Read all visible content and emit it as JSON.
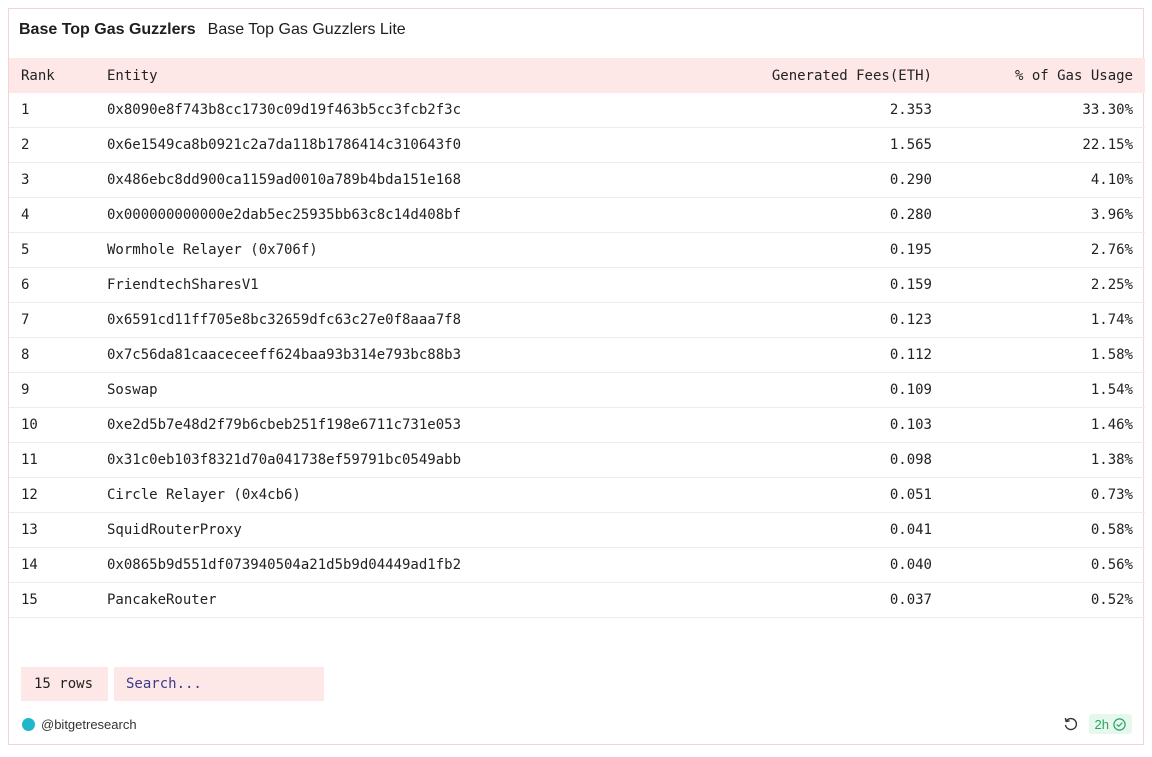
{
  "header": {
    "title": "Base Top Gas Guzzlers",
    "subtitle": "Base Top Gas Guzzlers Lite"
  },
  "table": {
    "columns": [
      "Rank",
      "Entity",
      "Generated Fees(ETH)",
      "% of Gas Usage"
    ],
    "rows": [
      {
        "rank": "1",
        "entity": "0x8090e8f743b8cc1730c09d19f463b5cc3fcb2f3c",
        "fees": "2.353",
        "pct": "33.30%"
      },
      {
        "rank": "2",
        "entity": "0x6e1549ca8b0921c2a7da118b1786414c310643f0",
        "fees": "1.565",
        "pct": "22.15%"
      },
      {
        "rank": "3",
        "entity": "0x486ebc8dd900ca1159ad0010a789b4bda151e168",
        "fees": "0.290",
        "pct": "4.10%"
      },
      {
        "rank": "4",
        "entity": "0x000000000000e2dab5ec25935bb63c8c14d408bf",
        "fees": "0.280",
        "pct": "3.96%"
      },
      {
        "rank": "5",
        "entity": "Wormhole Relayer (0x706f)",
        "fees": "0.195",
        "pct": "2.76%"
      },
      {
        "rank": "6",
        "entity": "FriendtechSharesV1",
        "fees": "0.159",
        "pct": "2.25%"
      },
      {
        "rank": "7",
        "entity": "0x6591cd11ff705e8bc32659dfc63c27e0f8aaa7f8",
        "fees": "0.123",
        "pct": "1.74%"
      },
      {
        "rank": "8",
        "entity": "0x7c56da81caaceceeff624baa93b314e793bc88b3",
        "fees": "0.112",
        "pct": "1.58%"
      },
      {
        "rank": "9",
        "entity": "Soswap",
        "fees": "0.109",
        "pct": "1.54%"
      },
      {
        "rank": "10",
        "entity": "0xe2d5b7e48d2f79b6cbeb251f198e6711c731e053",
        "fees": "0.103",
        "pct": "1.46%"
      },
      {
        "rank": "11",
        "entity": "0x31c0eb103f8321d70a041738ef59791bc0549abb",
        "fees": "0.098",
        "pct": "1.38%"
      },
      {
        "rank": "12",
        "entity": "Circle Relayer (0x4cb6)",
        "fees": "0.051",
        "pct": "0.73%"
      },
      {
        "rank": "13",
        "entity": "SquidRouterProxy",
        "fees": "0.041",
        "pct": "0.58%"
      },
      {
        "rank": "14",
        "entity": "0x0865b9d551df073940504a21d5b9d04449ad1fb2",
        "fees": "0.040",
        "pct": "0.56%"
      },
      {
        "rank": "15",
        "entity": "PancakeRouter",
        "fees": "0.037",
        "pct": "0.52%"
      }
    ]
  },
  "footer": {
    "rows_label": "15 rows",
    "search_placeholder": "Search...",
    "author": "@bitgetresearch",
    "author_icon": "avatar-icon",
    "refresh_icon": "refresh-icon",
    "age": "2h",
    "age_icon": "check-circle-icon"
  },
  "colors": {
    "header_bg": "#fde8e7",
    "border": "#f3d4d2",
    "badge_bg": "#e7f7ee",
    "badge_text": "#2aa463",
    "avatar": "#1fb7c9"
  }
}
